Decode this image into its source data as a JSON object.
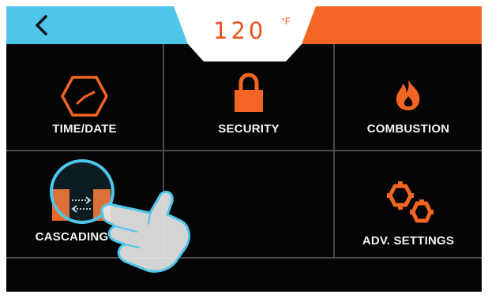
{
  "header": {
    "back_icon": "chevron-left-icon",
    "temperature": {
      "value": "120",
      "unit": "°F"
    },
    "colors": {
      "left": "#4dc6ea",
      "right": "#f26522",
      "accent": "#e8531f"
    }
  },
  "menu": {
    "time_date": {
      "label": "TIME/DATE",
      "icon": "clock-icon"
    },
    "security": {
      "label": "SECURITY",
      "icon": "lock-icon"
    },
    "combustion": {
      "label": "COMBUSTION",
      "icon": "flame-icon"
    },
    "cascading": {
      "label": "CASCADING",
      "icon": "cascading-icon"
    },
    "adv_settings": {
      "label": "ADV. SETTINGS",
      "icon": "gears-icon"
    }
  },
  "overlay": {
    "pointer_icon": "pointing-hand-icon",
    "highlight_color": "#4dc6ea"
  }
}
